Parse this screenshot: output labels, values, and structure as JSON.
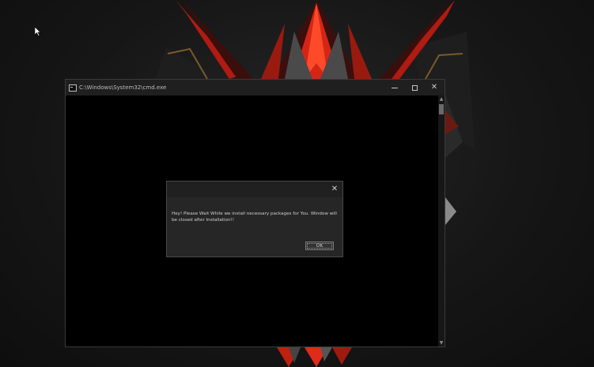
{
  "console_window": {
    "title": "C:\\Windows\\System32\\cmd.exe",
    "buttons": {
      "minimize": "minimize",
      "maximize": "maximize",
      "close": "close"
    }
  },
  "dialog": {
    "message": "Hey! Please Wait While we install necessary packages for You. Window will be closed after Installation!!",
    "ok_label": "OK",
    "close_glyph": "✕"
  },
  "colors": {
    "accent_red": "#e02a1a",
    "console_background": "#000000",
    "dialog_background": "#262626"
  },
  "icons": [
    "console-app-icon",
    "minimize-icon",
    "maximize-icon",
    "close-icon",
    "dialog-close-icon",
    "mouse-cursor-icon"
  ]
}
